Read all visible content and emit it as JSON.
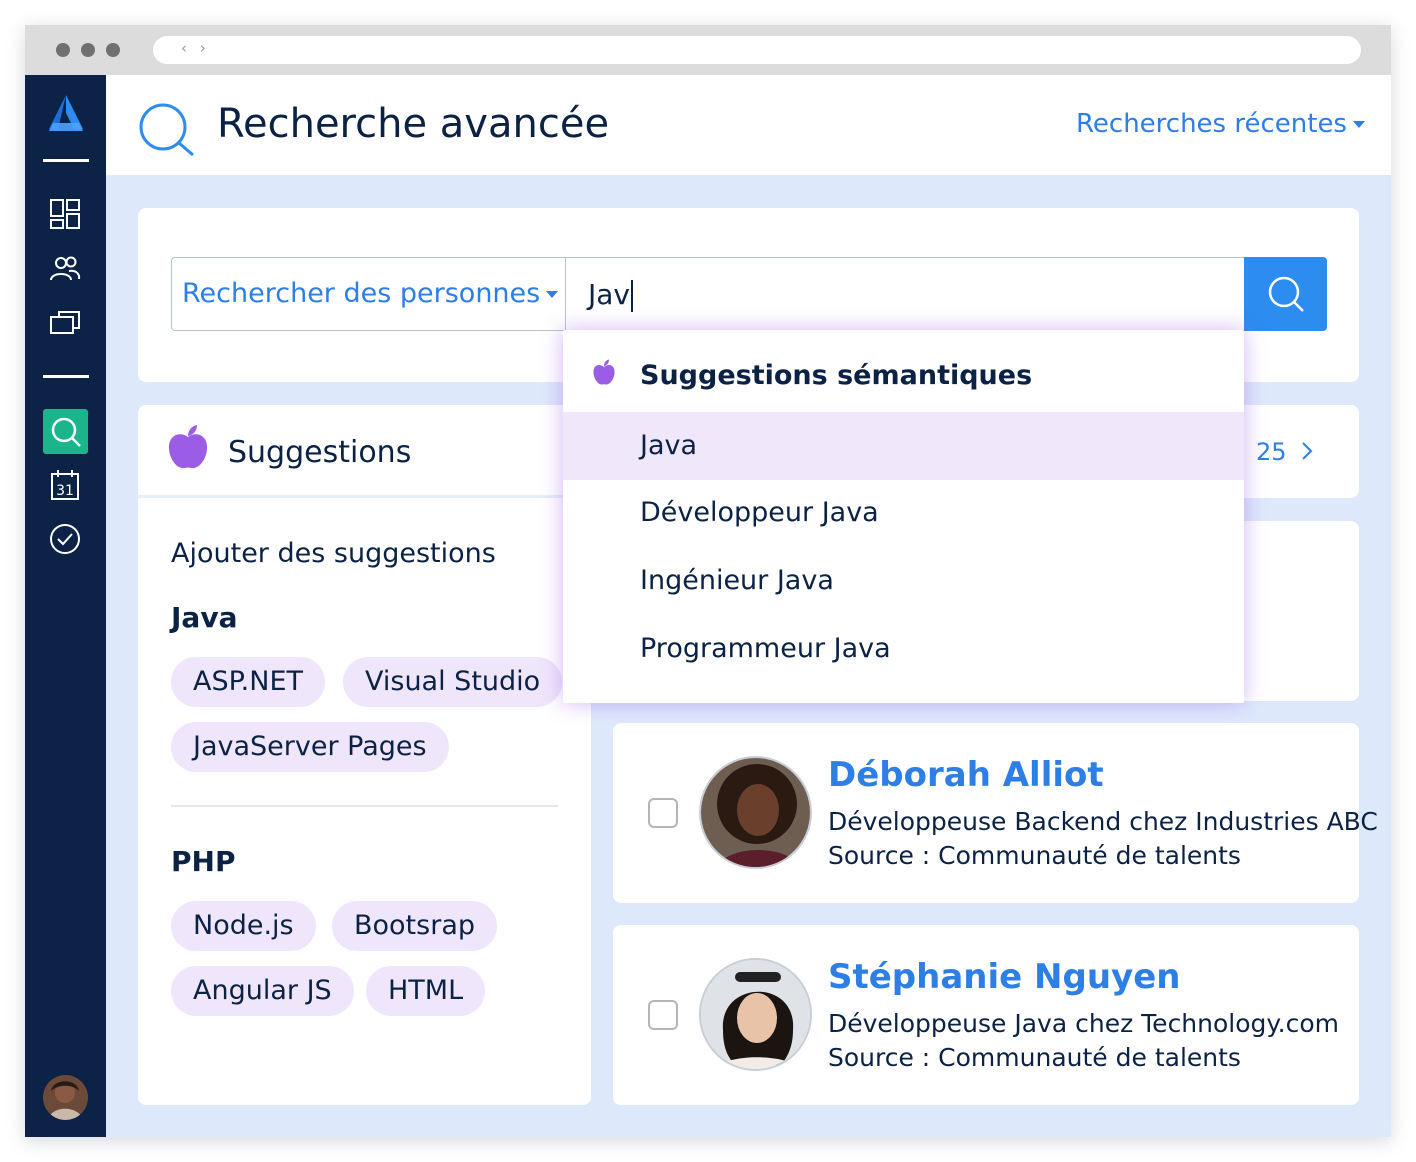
{
  "header": {
    "title": "Recherche avancée",
    "recent_searches": "Recherches récentes"
  },
  "search": {
    "scope": "Rechercher des personnes",
    "query": "Jav"
  },
  "dropdown": {
    "title": "Suggestions sémantiques",
    "items": [
      "Java",
      "Développeur Java",
      "Ingénieur Java",
      "Programmeur Java"
    ]
  },
  "suggestions": {
    "title": "Suggestions",
    "add_label": "Ajouter des suggestions",
    "groups": [
      {
        "title": "Java",
        "chips": [
          "ASP.NET",
          "Visual Studio",
          "JavaServer Pages"
        ]
      },
      {
        "title": "PHP",
        "chips": [
          "Node.js",
          "Bootsrap",
          "Angular JS",
          "HTML"
        ]
      }
    ]
  },
  "results": {
    "count": "25",
    "people": [
      {
        "name": "Déborah Alliot",
        "role": "Développeuse Backend chez Industries ABC",
        "source": "Source : Communauté de talents"
      },
      {
        "name": "Stéphanie Nguyen",
        "role": "Développeuse Java chez Technology.com",
        "source": "Source : Communauté de talents"
      }
    ]
  },
  "colors": {
    "sidebar": "#0c2347",
    "accent_blue": "#2d7ee5",
    "search_button": "#2d8cf0",
    "active_nav": "#1bb58b",
    "chip": "#efe6fb",
    "apple_purple": "#9b5de5",
    "background": "#dde9fb"
  },
  "icons": {
    "sidebar": [
      "logo-icon",
      "dashboard-icon",
      "people-icon",
      "jobs-icon",
      "search-icon",
      "calendar-icon",
      "check-circle-icon"
    ],
    "calendar_day": "31"
  }
}
